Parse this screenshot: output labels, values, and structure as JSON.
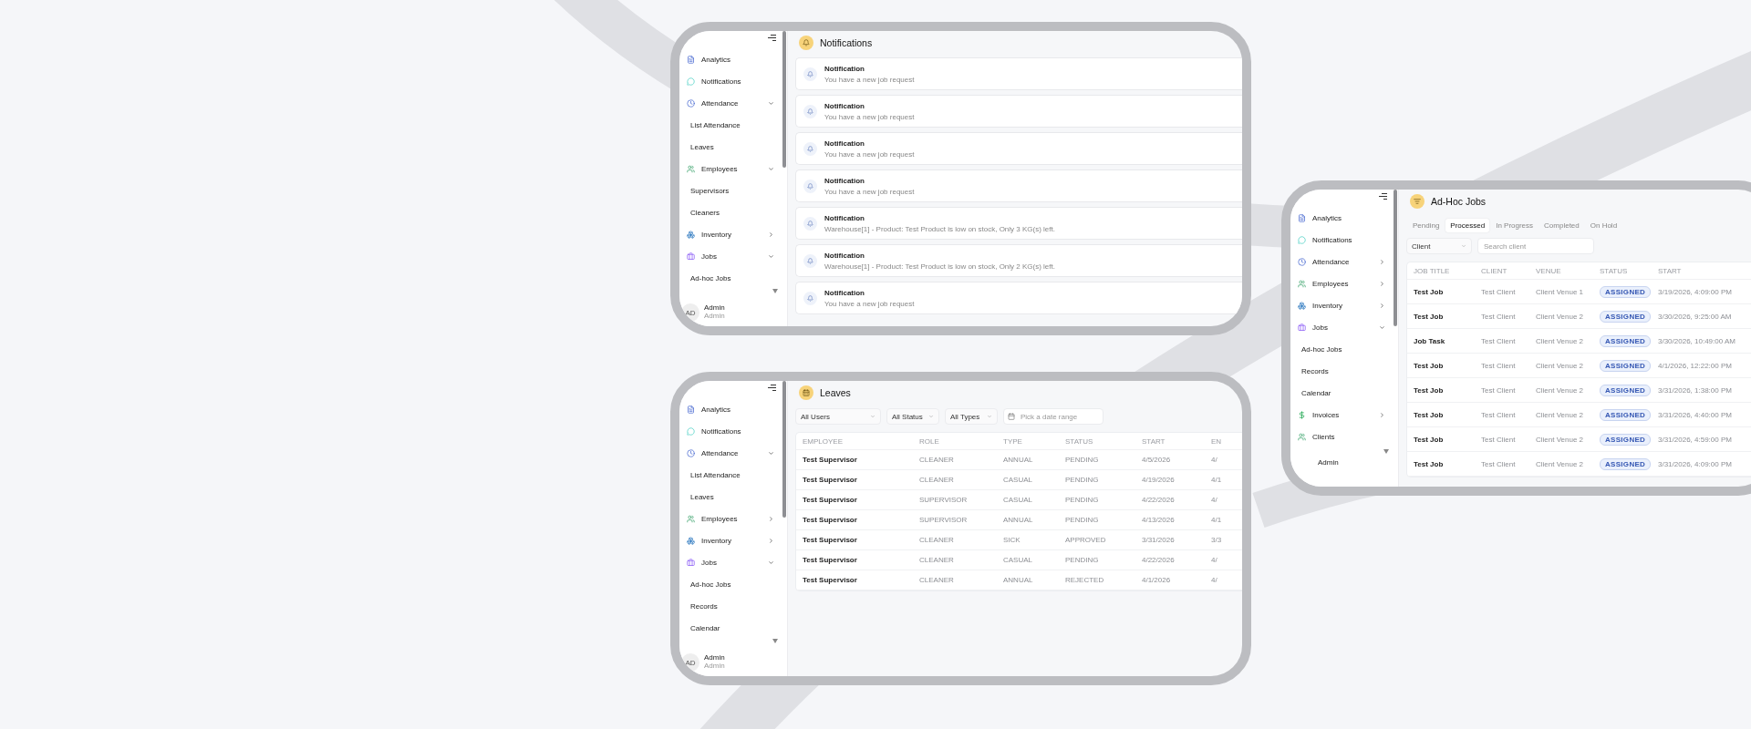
{
  "panels": [
    {
      "kind": "notifications",
      "title": "Notifications",
      "sidebar": [
        {
          "kind": "analytics",
          "label": "Analytics"
        },
        {
          "kind": "notifications",
          "label": "Notifications"
        },
        {
          "kind": "attendance",
          "label": "Attendance",
          "expanded": true,
          "children": [
            {
              "label": "List Attendance"
            },
            {
              "label": "Leaves"
            }
          ]
        },
        {
          "kind": "employees",
          "label": "Employees",
          "expanded": true,
          "children": [
            {
              "label": "Supervisors"
            },
            {
              "label": "Cleaners"
            }
          ]
        },
        {
          "kind": "inventory",
          "label": "Inventory",
          "expanded": false
        },
        {
          "kind": "jobs",
          "label": "Jobs",
          "expanded": true,
          "children": [
            {
              "label": "Ad-hoc Jobs"
            }
          ]
        }
      ],
      "user": {
        "initials": "AD",
        "name": "Admin",
        "role": "Admin"
      },
      "notifications": [
        {
          "title": "Notification",
          "message": "You have a new job request"
        },
        {
          "title": "Notification",
          "message": "You have a new job request"
        },
        {
          "title": "Notification",
          "message": "You have a new job request"
        },
        {
          "title": "Notification",
          "message": "You have a new job request"
        },
        {
          "title": "Notification",
          "message": "Warehouse[1] - Product: Test Product is low on stock, Only 3 KG(s) left."
        },
        {
          "title": "Notification",
          "message": "Warehouse[1] - Product: Test Product is low on stock, Only 2 KG(s) left."
        },
        {
          "title": "Notification",
          "message": "You have a new job request"
        }
      ]
    },
    {
      "kind": "leaves",
      "title": "Leaves",
      "sidebar": [
        {
          "kind": "analytics",
          "label": "Analytics"
        },
        {
          "kind": "notifications",
          "label": "Notifications"
        },
        {
          "kind": "attendance",
          "label": "Attendance",
          "expanded": true,
          "children": [
            {
              "label": "List Attendance"
            },
            {
              "label": "Leaves"
            }
          ]
        },
        {
          "kind": "employees",
          "label": "Employees",
          "expanded": false
        },
        {
          "kind": "inventory",
          "label": "Inventory",
          "expanded": false
        },
        {
          "kind": "jobs",
          "label": "Jobs",
          "expanded": true,
          "children": [
            {
              "label": "Ad-hoc Jobs"
            },
            {
              "label": "Records"
            },
            {
              "label": "Calendar"
            }
          ]
        }
      ],
      "user": {
        "initials": "AD",
        "name": "Admin",
        "role": "Admin"
      },
      "filters": [
        {
          "kind": "select",
          "label": "All Users"
        },
        {
          "kind": "select",
          "label": "All Status"
        },
        {
          "kind": "select",
          "label": "All Types"
        },
        {
          "kind": "date",
          "placeholder": "Pick a date range"
        }
      ],
      "table": {
        "columns": [
          "EMPLOYEE",
          "ROLE",
          "TYPE",
          "STATUS",
          "START",
          "EN"
        ],
        "rows": [
          [
            "Test Supervisor",
            "CLEANER",
            "ANNUAL",
            "PENDING",
            "4/5/2026",
            "4/"
          ],
          [
            "Test Supervisor",
            "CLEANER",
            "CASUAL",
            "PENDING",
            "4/19/2026",
            "4/1"
          ],
          [
            "Test Supervisor",
            "SUPERVISOR",
            "CASUAL",
            "PENDING",
            "4/22/2026",
            "4/"
          ],
          [
            "Test Supervisor",
            "SUPERVISOR",
            "ANNUAL",
            "PENDING",
            "4/13/2026",
            "4/1"
          ],
          [
            "Test Supervisor",
            "CLEANER",
            "SICK",
            "APPROVED",
            "3/31/2026",
            "3/3"
          ],
          [
            "Test Supervisor",
            "CLEANER",
            "CASUAL",
            "PENDING",
            "4/22/2026",
            "4/"
          ],
          [
            "Test Supervisor",
            "CLEANER",
            "ANNUAL",
            "REJECTED",
            "4/1/2026",
            "4/"
          ]
        ]
      }
    },
    {
      "kind": "jobs",
      "title": "Ad-Hoc Jobs",
      "sidebar": [
        {
          "kind": "analytics",
          "label": "Analytics"
        },
        {
          "kind": "notifications",
          "label": "Notifications"
        },
        {
          "kind": "attendance",
          "label": "Attendance",
          "expanded": false
        },
        {
          "kind": "employees",
          "label": "Employees",
          "expanded": false
        },
        {
          "kind": "inventory",
          "label": "Inventory",
          "expanded": false
        },
        {
          "kind": "jobs",
          "label": "Jobs",
          "expanded": true,
          "children": [
            {
              "label": "Ad-hoc Jobs"
            },
            {
              "label": "Records"
            },
            {
              "label": "Calendar"
            }
          ]
        },
        {
          "kind": "invoices",
          "label": "Invoices",
          "expanded": false
        },
        {
          "kind": "clients",
          "label": "Clients"
        }
      ],
      "user": {
        "name": "Admin"
      },
      "tabs": [
        {
          "label": "Pending",
          "selected": false
        },
        {
          "label": "Processed",
          "selected": true
        },
        {
          "label": "In Progress",
          "selected": false
        },
        {
          "label": "Completed",
          "selected": false
        },
        {
          "label": "On Hold",
          "selected": false
        }
      ],
      "filters": [
        {
          "kind": "select",
          "label": "Client"
        },
        {
          "kind": "search",
          "placeholder": "Search client"
        }
      ],
      "table": {
        "columns": [
          "JOB TITLE",
          "CLIENT",
          "VENUE",
          "STATUS",
          "START"
        ],
        "rows": [
          [
            "Test Job",
            "Test Client",
            "Client Venue 1",
            "ASSIGNED",
            "3/19/2026, 4:09:00 PM"
          ],
          [
            "Test Job",
            "Test Client",
            "Client Venue 2",
            "ASSIGNED",
            "3/30/2026, 9:25:00 AM"
          ],
          [
            "Job Task",
            "Test Client",
            "Client Venue 2",
            "ASSIGNED",
            "3/30/2026, 10:49:00 AM"
          ],
          [
            "Test Job",
            "Test Client",
            "Client Venue 2",
            "ASSIGNED",
            "4/1/2026, 12:22:00 PM"
          ],
          [
            "Test Job",
            "Test Client",
            "Client Venue 2",
            "ASSIGNED",
            "3/31/2026, 1:38:00 PM"
          ],
          [
            "Test Job",
            "Test Client",
            "Client Venue 2",
            "ASSIGNED",
            "3/31/2026, 4:40:00 PM"
          ],
          [
            "Test Job",
            "Test Client",
            "Client Venue 2",
            "ASSIGNED",
            "3/31/2026, 4:59:00 PM"
          ],
          [
            "Test Job",
            "Test Client",
            "Client Venue 2",
            "ASSIGNED",
            "3/31/2026, 4:09:00 PM"
          ]
        ]
      }
    }
  ]
}
